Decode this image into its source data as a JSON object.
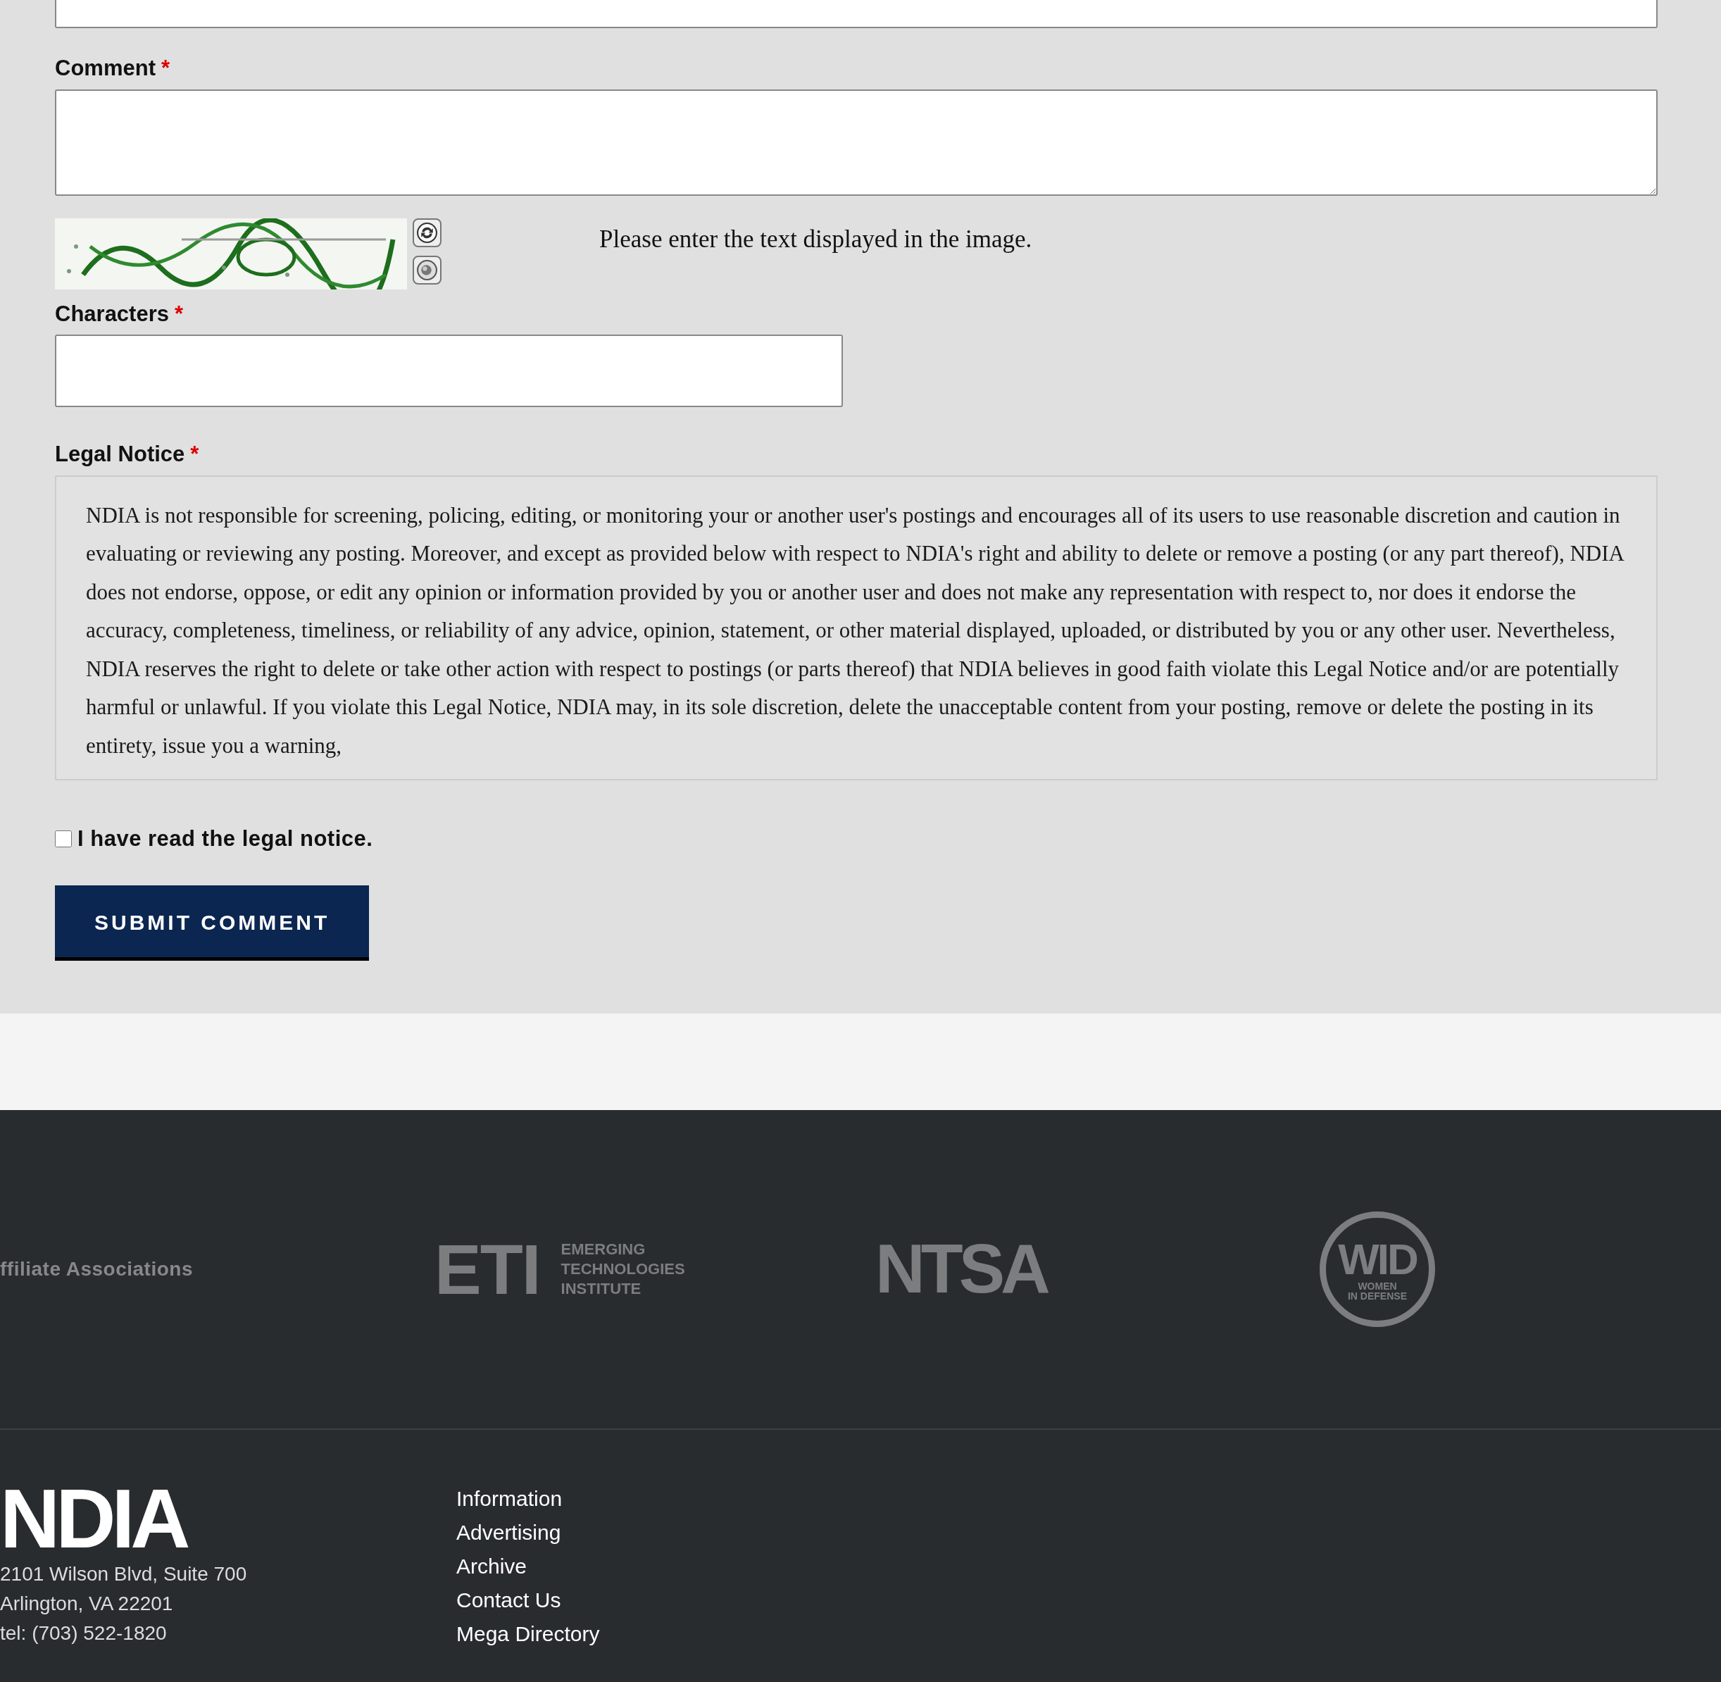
{
  "form": {
    "fields": [
      {
        "kind": "text_input"
      },
      {
        "kind": "textarea",
        "label": "Comment",
        "required_mark": "*"
      },
      {
        "kind": "captcha",
        "hint": "Please enter the text displayed in the image."
      },
      {
        "kind": "short_input",
        "label": "Characters",
        "required_mark": "*"
      }
    ],
    "legal_notice": {
      "label": "Legal Notice",
      "required_mark": "*",
      "text": "NDIA is not responsible for screening, policing, editing, or monitoring your or another user's postings and encourages all of its users to use reasonable discretion and caution in evaluating or reviewing any posting. Moreover, and except as provided below with respect to NDIA's right and ability to delete or remove a posting (or any part thereof), NDIA does not endorse, oppose, or edit any opinion or information provided by you or another user and does not make any representation with respect to, nor does it endorse the accuracy, completeness, timeliness, or reliability of any advice, opinion, statement, or other material displayed, uploaded, or distributed by you or any other user. Nevertheless, NDIA reserves the right to delete or take other action with respect to postings (or parts thereof) that NDIA believes in good faith violate this Legal Notice and/or are potentially harmful or unlawful. If you violate this Legal Notice, NDIA may, in its sole discretion, delete the unacceptable content from your posting, remove or delete the posting in its entirety, issue you a warning,"
    },
    "agreement": {
      "label": "I have read the legal notice.",
      "checked": false
    },
    "submit": {
      "label": "SUBMIT COMMENT"
    }
  },
  "affiliates": {
    "heading": "ffiliate Associations",
    "logos": [
      {
        "kind": "eti",
        "mark": "ETI",
        "lines": [
          "EMERGING",
          "TECHNOLOGIES",
          "INSTITUTE"
        ]
      },
      {
        "kind": "ntsa",
        "mark": "NTSA"
      },
      {
        "kind": "wid",
        "mark": "WID",
        "lines": [
          "WOMEN",
          "IN DEFENSE"
        ]
      }
    ]
  },
  "footer": {
    "logo": "NDIA",
    "address": [
      "2101 Wilson Blvd, Suite 700",
      "Arlington, VA 22201",
      "tel: (703) 522-1820"
    ],
    "links": [
      "Information",
      "Advertising",
      "Archive",
      "Contact Us",
      "Mega Directory"
    ]
  }
}
